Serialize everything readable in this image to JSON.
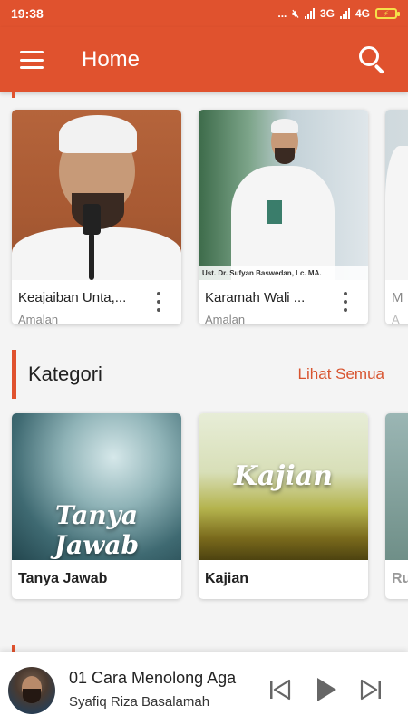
{
  "status": {
    "time": "19:38",
    "dots": "...",
    "net1": "3G",
    "net2": "4G"
  },
  "app_bar": {
    "title": "Home"
  },
  "recent": [
    {
      "title": "Keajaiban Unta,...",
      "subtitle": "Amalan"
    },
    {
      "title": "Karamah Wali ...",
      "subtitle": "Amalan",
      "banner": "Ust. Dr. Sufyan Baswedan, Lc. MA."
    },
    {
      "title": "M",
      "subtitle": "A"
    }
  ],
  "kategori": {
    "heading": "Kategori",
    "see_all": "Lihat Semua",
    "items": [
      {
        "title": "Tanya Jawab",
        "art_text": "Tanya Jawab"
      },
      {
        "title": "Kajian",
        "art_text": "Kajian"
      },
      {
        "title": "Ru"
      }
    ]
  },
  "player": {
    "track": "01 Cara Menolong Aga",
    "artist": "Syafiq Riza Basalamah"
  },
  "colors": {
    "primary": "#e0522e",
    "accent_text": "#d8542f"
  }
}
